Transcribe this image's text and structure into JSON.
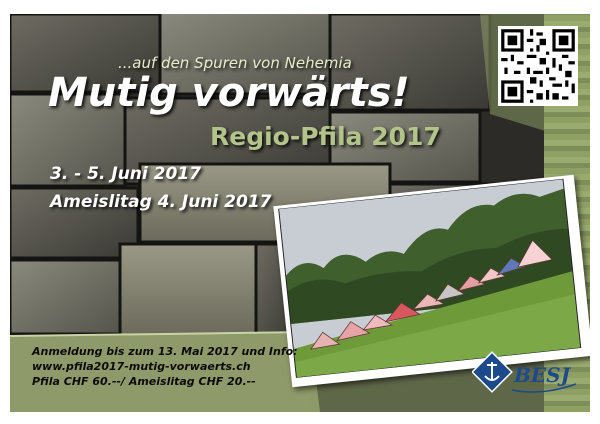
{
  "flyer": {
    "subtitle": "...auf den Spuren von Nehemia",
    "title": "Mutig vorwärts!",
    "event": "Regio-Pfila 2017",
    "dates": "3. - 5. Juni 2017",
    "day_line": "Ameislitag 4. Juni 2017",
    "info": {
      "registration": "Anmeldung bis zum 13. Mai 2017 und Info:",
      "website": "www.pfila2017-mutig-vorwaerts.ch",
      "prices": "Pfila CHF 60.--/ Ameislitag CHF 20.--"
    },
    "logo_text": "BESJ"
  },
  "colors": {
    "wall_dark": "#3a3a35",
    "wall_light": "#7a7a70",
    "accent_green": "#b3c48a",
    "panel_green": "#8f9a6a",
    "title_white": "#ffffff",
    "logo_blue": "#1d4a8a"
  },
  "icons": [
    "qr-code-icon",
    "anchor-icon"
  ]
}
